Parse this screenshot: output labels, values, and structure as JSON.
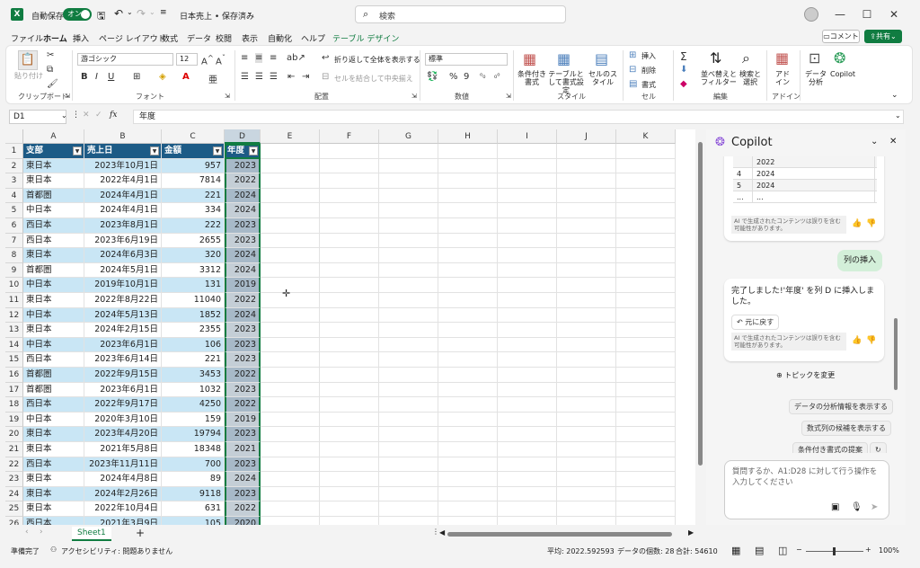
{
  "titlebar": {
    "autosave_label": "自動保存",
    "autosave_toggle": "オン",
    "doc_title": "日本売上 • 保存済み",
    "search_placeholder": "検索"
  },
  "menu": {
    "tabs": [
      "ファイル",
      "ホーム",
      "挿入",
      "ページ レイアウト",
      "数式",
      "データ",
      "校閲",
      "表示",
      "自動化",
      "ヘルプ",
      "テーブル デザイン"
    ],
    "comment_label": "コメント",
    "share_label": "共有"
  },
  "ribbon": {
    "clipboard": {
      "paste": "貼り付け",
      "group": "クリップボード"
    },
    "font": {
      "name": "游ゴシック",
      "size": "12",
      "group": "フォント"
    },
    "align": {
      "wrap": "折り返して全体を表示する",
      "merge": "セルを結合して中央揃え",
      "group": "配置"
    },
    "number": {
      "format": "標準",
      "group": "数値"
    },
    "style": {
      "cond": "条件付き書式",
      "table": "テーブルとして書式設定",
      "cellstyle": "セルのスタイル",
      "group": "スタイル"
    },
    "cells": {
      "insert": "挿入",
      "delete": "削除",
      "format": "書式",
      "group": "セル"
    },
    "edit": {
      "sort": "並べ替えとフィルター",
      "find": "検索と選択",
      "group": "編集"
    },
    "addin": {
      "addin": "アドイン",
      "analyze": "データ分析",
      "copilot": "Copilot",
      "group": "アドイン"
    }
  },
  "formula": {
    "namebox": "D1",
    "fx": "fx",
    "value": "年度"
  },
  "columns": [
    "A",
    "B",
    "C",
    "D",
    "E",
    "F",
    "G",
    "H",
    "I",
    "J",
    "K"
  ],
  "table": {
    "headers": [
      "支部",
      "売上日",
      "金額",
      "年度"
    ],
    "rows": [
      [
        "東日本",
        "2023年10月1日",
        "957",
        "2023"
      ],
      [
        "東日本",
        "2022年4月1日",
        "7814",
        "2022"
      ],
      [
        "首都圏",
        "2024年4月1日",
        "221",
        "2024"
      ],
      [
        "中日本",
        "2024年4月1日",
        "334",
        "2024"
      ],
      [
        "西日本",
        "2023年8月1日",
        "222",
        "2023"
      ],
      [
        "西日本",
        "2023年6月19日",
        "2655",
        "2023"
      ],
      [
        "東日本",
        "2024年6月3日",
        "320",
        "2024"
      ],
      [
        "首都圏",
        "2024年5月1日",
        "3312",
        "2024"
      ],
      [
        "中日本",
        "2019年10月1日",
        "131",
        "2019"
      ],
      [
        "東日本",
        "2022年8月22日",
        "11040",
        "2022"
      ],
      [
        "中日本",
        "2024年5月13日",
        "1852",
        "2024"
      ],
      [
        "東日本",
        "2024年2月15日",
        "2355",
        "2023"
      ],
      [
        "中日本",
        "2023年6月1日",
        "106",
        "2023"
      ],
      [
        "西日本",
        "2023年6月14日",
        "221",
        "2023"
      ],
      [
        "首都圏",
        "2022年9月15日",
        "3453",
        "2022"
      ],
      [
        "首都圏",
        "2023年6月1日",
        "1032",
        "2023"
      ],
      [
        "西日本",
        "2022年9月17日",
        "4250",
        "2022"
      ],
      [
        "中日本",
        "2020年3月10日",
        "159",
        "2019"
      ],
      [
        "東日本",
        "2023年4月20日",
        "19794",
        "2023"
      ],
      [
        "東日本",
        "2021年5月8日",
        "18348",
        "2021"
      ],
      [
        "西日本",
        "2023年11月11日",
        "700",
        "2023"
      ],
      [
        "東日本",
        "2024年4月8日",
        "89",
        "2024"
      ],
      [
        "東日本",
        "2024年2月26日",
        "9118",
        "2023"
      ],
      [
        "東日本",
        "2022年10月4日",
        "631",
        "2022"
      ],
      [
        "西日本",
        "2021年3月9日",
        "105",
        "2020"
      ]
    ]
  },
  "sheet_tab": "Sheet1",
  "status": {
    "ready": "準備完了",
    "accessibility": "アクセシビリティ: 問題ありません",
    "average": "平均: 2022.592593",
    "count": "データの個数: 28",
    "sum": "合計: 54610",
    "zoom": "100%"
  },
  "copilot": {
    "title": "Copilot",
    "preview_rows": [
      [
        "",
        "2022"
      ],
      [
        "4",
        "2024"
      ],
      [
        "5",
        "2024"
      ],
      [
        "...",
        "..."
      ]
    ],
    "disclaimer": "AI で生成されたコンテンツは誤りを含む可能性があります。",
    "user_msg": "列の挿入",
    "reply": "完了しました!'年度' を列 D に挿入しました。",
    "undo": "元に戻す",
    "change_topic": "トピックを変更",
    "suggestions": [
      "データの分析情報を表示する",
      "数式列の候補を表示する",
      "条件付き書式の提案"
    ],
    "input_placeholder": "質問するか、A1:D28 に対して行う操作を入力してください"
  }
}
